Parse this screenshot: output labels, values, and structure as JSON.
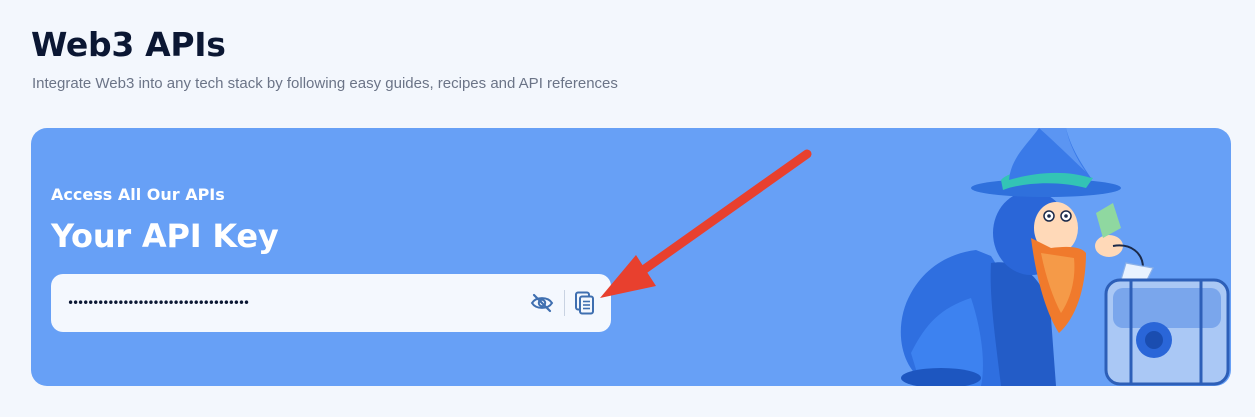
{
  "header": {
    "title": "Web3 APIs",
    "subtitle": "Integrate Web3 into any tech stack by following easy guides, recipes and API references"
  },
  "api_card": {
    "eyebrow": "Access All Our APIs",
    "title": "Your API Key",
    "key_masked": "••••••••••••••••••••••••••••••••••••",
    "icons": {
      "visibility": "eye-off-icon",
      "copy": "copy-icon"
    }
  },
  "colors": {
    "page_background": "#f3f7fd",
    "card_background": "#67a0f6",
    "title_text": "#0b1733",
    "icon_accent": "#3f6fb0",
    "annotation_arrow": "#e8402e"
  }
}
